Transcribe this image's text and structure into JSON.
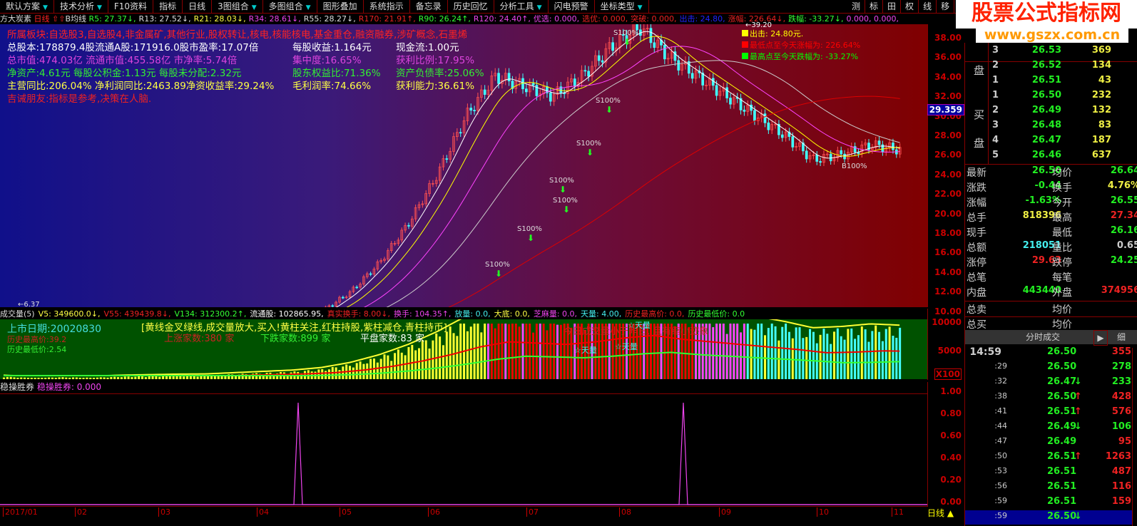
{
  "toolbar": {
    "items": [
      "默认方案",
      "技术分析",
      "F10资料",
      "指标",
      "日线",
      "3图组合",
      "多图组合",
      "图形叠加",
      "系统指示",
      "备忘录",
      "历史回忆",
      "分析工具",
      "闪电预警",
      "坐标类型"
    ],
    "right": [
      "测",
      "标",
      "田",
      "权",
      "线",
      "移",
      "▣",
      "▶"
    ]
  },
  "logo": {
    "text": "股票公式指标网",
    "url": "www.gszx.com.cn"
  },
  "ticker": {
    "name": "方大炭素",
    "period": "日线",
    "ma_name": "B均线",
    "items": [
      {
        "t": "R5: 27.37↓,",
        "c": "#3f3"
      },
      {
        "t": "R13: 27.52↓,",
        "c": "#ddd"
      },
      {
        "t": "R21: 28.03↓,",
        "c": "#ff4"
      },
      {
        "t": "R34: 28.61↓,",
        "c": "#e4e"
      },
      {
        "t": "R55: 28.27↓,",
        "c": "#ddd"
      },
      {
        "t": "R170: 21.91↑,",
        "c": "#e22"
      },
      {
        "t": "R90: 26.24↑,",
        "c": "#3f3"
      },
      {
        "t": "R120: 24.40↑,",
        "c": "#e4e"
      },
      {
        "t": "优选: 0.000,",
        "c": "#e4e"
      },
      {
        "t": "选优: 0.000,",
        "c": "#e22"
      },
      {
        "t": "突破: 0.000,",
        "c": "#e22"
      },
      {
        "t": "出击: 24.80,",
        "c": "#22f"
      },
      {
        "t": "涨幅: 226.64↓,",
        "c": "#e22"
      },
      {
        "t": "跌幅: -33.27↓,",
        "c": "#3f3"
      },
      {
        "t": "0.000, 0.000,",
        "c": "#e4e"
      }
    ]
  },
  "info": {
    "lines": [
      [
        {
          "t": "所属板块:自选股3,自选股4,非金属矿,其他行业,股权转让,核电,核能核电,基金重仓,融资融券,涉矿概念,石墨烯",
          "c": "#f22"
        }
      ],
      [
        {
          "t": "总股本:178879.4股流通A股:171916.0股市盈率:17.07倍",
          "c": "#fff"
        },
        {
          "t": "每股收益:1.164元",
          "c": "#fff"
        },
        {
          "t": "现金流:1.00元",
          "c": "#fff"
        }
      ],
      [
        {
          "t": "总市值:474.03亿  流通市值:455.58亿  市净率:5.74倍",
          "c": "#d4d"
        },
        {
          "t": "集中度:16.65%",
          "c": "#d4d"
        },
        {
          "t": "获利比例:17.95%",
          "c": "#d4d"
        }
      ],
      [
        {
          "t": "净资产:4.61元    每股公积金:1.13元  每股未分配:2.32元",
          "c": "#3e3"
        },
        {
          "t": "股东权益比:71.36%",
          "c": "#3e3"
        },
        {
          "t": "资产负债率:25.06%",
          "c": "#3e3"
        }
      ],
      [
        {
          "t": "主营同比:206.04% 净利润同比:2463.89净资收益率:29.24%",
          "c": "#ff4"
        },
        {
          "t": "毛利润率:74.66%",
          "c": "#ff4"
        },
        {
          "t": "获利能力:36.61%",
          "c": "#ff4"
        }
      ],
      [
        {
          "t": "吉诫朋友:指标是参考,决策在人脑.",
          "c": "#e22"
        }
      ]
    ]
  },
  "legend": [
    {
      "t": "出击: 24.80元.",
      "c": "#ff0"
    },
    {
      "t": "最低点至今天涨幅为: 226.64%",
      "c": "#f00"
    },
    {
      "t": "最高点至今天跌幅为: -33.27%",
      "c": "#0f0"
    }
  ],
  "annotations": {
    "peak": "←39.20",
    "low": "←6.37",
    "s100": "S100%",
    "b100": "B100%",
    "current_price": "29.359"
  },
  "price_axis": [
    "38.00",
    "36.00",
    "34.00",
    "32.00",
    "30.00",
    "28.00",
    "26.00",
    "24.00",
    "22.00",
    "20.00",
    "18.00",
    "16.00",
    "14.00",
    "12.00",
    "10.00"
  ],
  "price_path": [
    7,
    6.5,
    6.8,
    6.6,
    7,
    7.2,
    7.4,
    7.5,
    8,
    8.5,
    9,
    10,
    12,
    15,
    19,
    24,
    30,
    34,
    33,
    32,
    34,
    37,
    39,
    36,
    34,
    32,
    30,
    28,
    25.5,
    26,
    27,
    26.5
  ],
  "volume": {
    "header": [
      {
        "t": "成交量(5)",
        "c": "#ddd"
      },
      {
        "t": "V5: 349600.0↓,",
        "c": "#ff4"
      },
      {
        "t": "V55: 439439.8↓,",
        "c": "#e22"
      },
      {
        "t": "V134: 312300.2↑,",
        "c": "#3f3"
      },
      {
        "t": "流通股: 102865.95,",
        "c": "#fff"
      },
      {
        "t": "真实换手: 8.00↓,",
        "c": "#e22"
      },
      {
        "t": "换手: 104.35↑,",
        "c": "#e4e"
      },
      {
        "t": "放量: 0.0,",
        "c": "#4ee"
      },
      {
        "t": "大底: 0.0,",
        "c": "#ff4"
      },
      {
        "t": "芝麻量: 0.0,",
        "c": "#e4e"
      },
      {
        "t": "天量: 4.00,",
        "c": "#4ee"
      },
      {
        "t": "历史最高价: 0.0,",
        "c": "#e22"
      },
      {
        "t": "历史最低价: 0.0",
        "c": "#3f3"
      }
    ],
    "listing": "上市日期:20020830",
    "hist_high": "历史最高价:39.2",
    "hist_low": "历史最低价:2.54",
    "tip": "[黄线金叉绿线,成交量放大,买入!黄柱关注,红柱持股,紫柱减仓,青柱持币]",
    "up": "上涨家数:380 家",
    "down": "下跌家数:899 家",
    "flat": "平盘家数:83 家",
    "msg": "今日成交量小于昨日, 且有缩小迹象",
    "tianliang": "☆天量",
    "axis": [
      "10000",
      "5000"
    ],
    "unit": "X100"
  },
  "lower": {
    "name": "稳操胜券",
    "value": "稳操胜券: 0.000",
    "axis": [
      "1.00",
      "0.80",
      "0.60",
      "0.40",
      "0.20",
      "0.00"
    ]
  },
  "xaxis": [
    "2017/01",
    "02",
    "03",
    "04",
    "05",
    "06",
    "07",
    "08",
    "09",
    "10",
    "11"
  ],
  "bottom_tab": "日线",
  "orderbook": {
    "sell_label": "盘",
    "buy_label1": "买",
    "buy_label2": "盘",
    "sell": [
      [
        "3",
        "26.53",
        "369"
      ],
      [
        "2",
        "26.52",
        "134"
      ],
      [
        "1",
        "26.51",
        "43"
      ]
    ],
    "buy": [
      [
        "1",
        "26.50",
        "232"
      ],
      [
        "2",
        "26.49",
        "132"
      ],
      [
        "3",
        "26.48",
        "83"
      ],
      [
        "4",
        "26.47",
        "187"
      ],
      [
        "5",
        "26.46",
        "637"
      ]
    ]
  },
  "stats": [
    [
      "最新",
      "26.50",
      "g",
      "均价",
      "26.64",
      "g"
    ],
    [
      "涨跌",
      "-0.44",
      "g",
      "换手",
      "4.76%",
      "y"
    ],
    [
      "涨幅",
      "-1.63%",
      "g",
      "今开",
      "26.55",
      "g"
    ],
    [
      "总手",
      "818396",
      "y",
      "最高",
      "27.34",
      "r"
    ],
    [
      "现手",
      "",
      "g",
      "最低",
      "26.16",
      "g"
    ],
    [
      "总额",
      "218051",
      "c",
      "量比",
      "0.65",
      "w"
    ],
    [
      "涨停",
      "29.63",
      "r",
      "跌停",
      "24.25",
      "g"
    ],
    [
      "总笔",
      "",
      "g",
      "每笔",
      "",
      "g"
    ],
    [
      "内盘",
      "443440",
      "g",
      "外盘",
      "374956",
      "r"
    ]
  ],
  "totals": [
    [
      "总卖",
      "均价"
    ],
    [
      "总买",
      "均价"
    ]
  ],
  "ticks": {
    "title": "分时成交",
    "detail": "细",
    "rows": [
      [
        "14:59",
        "26.50",
        "",
        "355",
        "r"
      ],
      [
        ":29",
        "26.50",
        "",
        "278",
        "g"
      ],
      [
        ":32",
        "26.47",
        "↓",
        "233",
        "g"
      ],
      [
        ":38",
        "26.50",
        "↑",
        "428",
        "r"
      ],
      [
        ":41",
        "26.51",
        "↑",
        "576",
        "r"
      ],
      [
        ":44",
        "26.49",
        "↓",
        "106",
        "g"
      ],
      [
        ":47",
        "26.49",
        "",
        "95",
        "r"
      ],
      [
        ":50",
        "26.51",
        "↑",
        "1263",
        "r"
      ],
      [
        ":53",
        "26.51",
        "",
        "487",
        "r"
      ],
      [
        ":56",
        "26.51",
        "",
        "116",
        "r"
      ],
      [
        ":59",
        "26.51",
        "",
        "159",
        "r"
      ],
      [
        ":59",
        "26.50",
        "↓",
        "",
        "g"
      ]
    ]
  }
}
